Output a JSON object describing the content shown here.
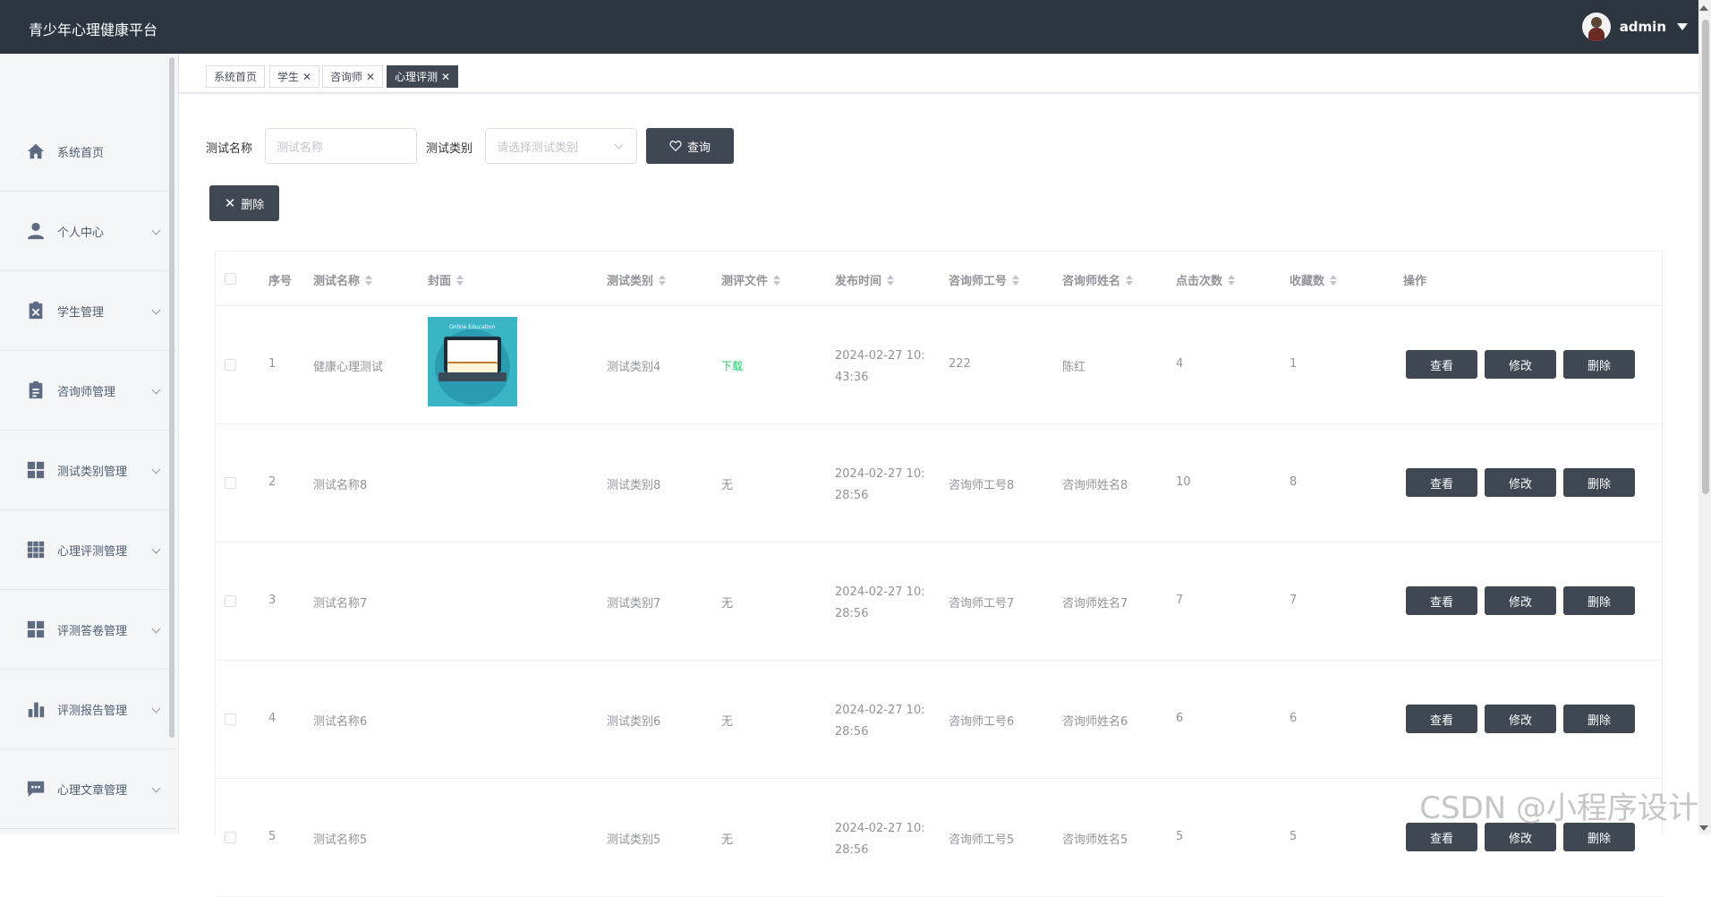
{
  "app": {
    "title": "青少年心理健康平台",
    "user": "admin"
  },
  "colors": {
    "topbar": "#2d3540",
    "accent_dark": "#3f4753",
    "link_green": "#13ce66"
  },
  "sidebar": {
    "items": [
      {
        "label": "系统首页",
        "icon": "home-icon"
      },
      {
        "label": "个人中心",
        "icon": "person-icon"
      },
      {
        "label": "学生管理",
        "icon": "clipboard-x-icon"
      },
      {
        "label": "咨询师管理",
        "icon": "clipboard-icon"
      },
      {
        "label": "测试类别管理",
        "icon": "grid-icon"
      },
      {
        "label": "心理评测管理",
        "icon": "grid-nine-icon"
      },
      {
        "label": "评测答卷管理",
        "icon": "grid-icon"
      },
      {
        "label": "评测报告管理",
        "icon": "bar-chart-icon"
      },
      {
        "label": "心理文章管理",
        "icon": "chat-icon"
      }
    ]
  },
  "tabs": [
    {
      "label": "系统首页"
    },
    {
      "label": "学生",
      "close": "✕"
    },
    {
      "label": "咨询师",
      "close": "✕"
    },
    {
      "label": "心理评测",
      "close": "✕"
    }
  ],
  "search": {
    "name_label": "测试名称",
    "name_placeholder": "测试名称",
    "type_label": "测试类别",
    "type_placeholder": "请选择测试类别",
    "query_button": "查询"
  },
  "toolbar": {
    "delete_button": "删除"
  },
  "table": {
    "headers": {
      "index": "序号",
      "name": "测试名称",
      "cover": "封面",
      "type": "测试类别",
      "file": "测评文件",
      "time": "发布时间",
      "counselor_id": "咨询师工号",
      "counselor_name": "咨询师姓名",
      "clicks": "点击次数",
      "favorites": "收藏数",
      "actions": "操作"
    },
    "cover_text": "Online Education",
    "row_actions": {
      "view": "查看",
      "edit": "修改",
      "delete": "删除"
    },
    "rows": [
      {
        "index": "1",
        "name": "健康心理测试",
        "type": "测试类别4",
        "file": "下载",
        "date": "2024-02-27 10:",
        "time": "43:36",
        "counselor_id": "222",
        "counselor_name": "陈红",
        "clicks": "4",
        "favorites": "1"
      },
      {
        "index": "2",
        "name": "测试名称8",
        "type": "测试类别8",
        "file": "无",
        "date": "2024-02-27 10:",
        "time": "28:56",
        "counselor_id": "咨询师工号8",
        "counselor_name": "咨询师姓名8",
        "clicks": "10",
        "favorites": "8"
      },
      {
        "index": "3",
        "name": "测试名称7",
        "type": "测试类别7",
        "file": "无",
        "date": "2024-02-27 10:",
        "time": "28:56",
        "counselor_id": "咨询师工号7",
        "counselor_name": "咨询师姓名7",
        "clicks": "7",
        "favorites": "7"
      },
      {
        "index": "4",
        "name": "测试名称6",
        "type": "测试类别6",
        "file": "无",
        "date": "2024-02-27 10:",
        "time": "28:56",
        "counselor_id": "咨询师工号6",
        "counselor_name": "咨询师姓名6",
        "clicks": "6",
        "favorites": "6"
      },
      {
        "index": "5",
        "name": "测试名称5",
        "type": "测试类别5",
        "file": "无",
        "date": "2024-02-27 10:",
        "time": "28:56",
        "counselor_id": "咨询师工号5",
        "counselor_name": "咨询师姓名5",
        "clicks": "5",
        "favorites": "5"
      }
    ]
  },
  "watermark": "CSDN @小程序设计"
}
